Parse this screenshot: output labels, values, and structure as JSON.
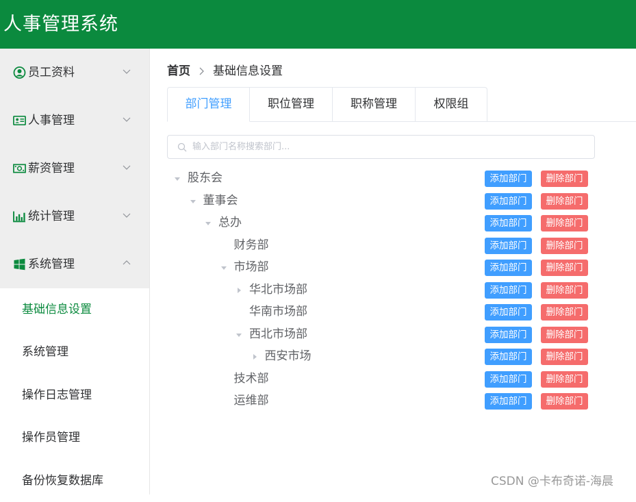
{
  "app": {
    "title": "人事管理系统"
  },
  "sidebar": {
    "menus": [
      {
        "label": "员工资料",
        "icon": "user-circle-icon",
        "expanded": false
      },
      {
        "label": "人事管理",
        "icon": "id-card-icon",
        "expanded": false
      },
      {
        "label": "薪资管理",
        "icon": "money-icon",
        "expanded": false
      },
      {
        "label": "统计管理",
        "icon": "bar-chart-icon",
        "expanded": false
      },
      {
        "label": "系统管理",
        "icon": "windows-icon",
        "expanded": true
      }
    ],
    "submenu": [
      {
        "label": "基础信息设置",
        "active": true
      },
      {
        "label": "系统管理",
        "active": false
      },
      {
        "label": "操作日志管理",
        "active": false
      },
      {
        "label": "操作员管理",
        "active": false
      },
      {
        "label": "备份恢复数据库",
        "active": false
      }
    ]
  },
  "breadcrumb": {
    "home": "首页",
    "current": "基础信息设置"
  },
  "tabs": [
    {
      "label": "部门管理",
      "active": true
    },
    {
      "label": "职位管理",
      "active": false
    },
    {
      "label": "职称管理",
      "active": false
    },
    {
      "label": "权限组",
      "active": false
    }
  ],
  "search": {
    "placeholder": "输入部门名称搜索部门...",
    "value": ""
  },
  "tree": {
    "add_label": "添加部门",
    "delete_label": "删除部门",
    "nodes": [
      {
        "label": "股东会",
        "caret": "expanded"
      },
      {
        "label": "董事会",
        "caret": "expanded"
      },
      {
        "label": "总办",
        "caret": "expanded"
      },
      {
        "label": "财务部",
        "caret": "none"
      },
      {
        "label": "市场部",
        "caret": "expanded"
      },
      {
        "label": "华北市场部",
        "caret": "collapsed"
      },
      {
        "label": "华南市场部",
        "caret": "none"
      },
      {
        "label": "西北市场部",
        "caret": "expanded"
      },
      {
        "label": "西安市场",
        "caret": "collapsed"
      },
      {
        "label": "技术部",
        "caret": "none"
      },
      {
        "label": "运维部",
        "caret": "none"
      }
    ]
  },
  "colors": {
    "header": "#0b8a3e",
    "primary": "#409eff",
    "danger": "#f56c6c",
    "active_menu": "#0b8a3e"
  },
  "watermark": "CSDN @卡布奇诺-海晨"
}
